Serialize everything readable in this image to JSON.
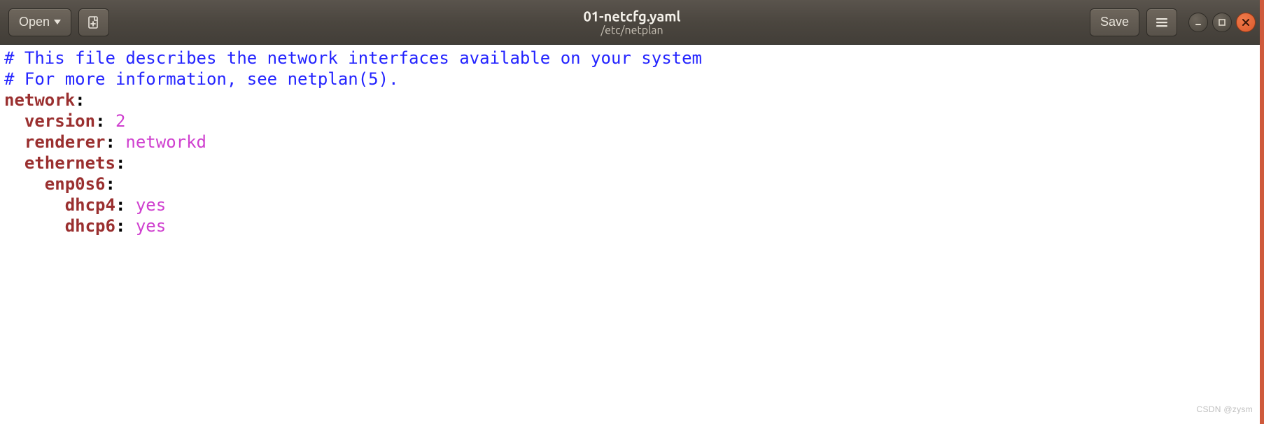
{
  "header": {
    "open_label": "Open",
    "save_label": "Save",
    "title_filename": "01-netcfg.yaml",
    "title_path": "/etc/netplan"
  },
  "code": {
    "comment1": "# This file describes the network interfaces available on your system",
    "comment2": "# For more information, see netplan(5).",
    "k_network": "network",
    "k_version": "version",
    "v_version": "2",
    "k_renderer": "renderer",
    "v_renderer": "networkd",
    "k_ethernets": "ethernets",
    "k_iface": "enp0s6",
    "k_dhcp4": "dhcp4",
    "v_dhcp4": "yes",
    "k_dhcp6": "dhcp6",
    "v_dhcp6": "yes",
    "indent1": "  ",
    "indent2": "    ",
    "indent3": "      ",
    "colon": ":",
    "colon_sp": ": "
  },
  "watermark": "CSDN @zysm"
}
